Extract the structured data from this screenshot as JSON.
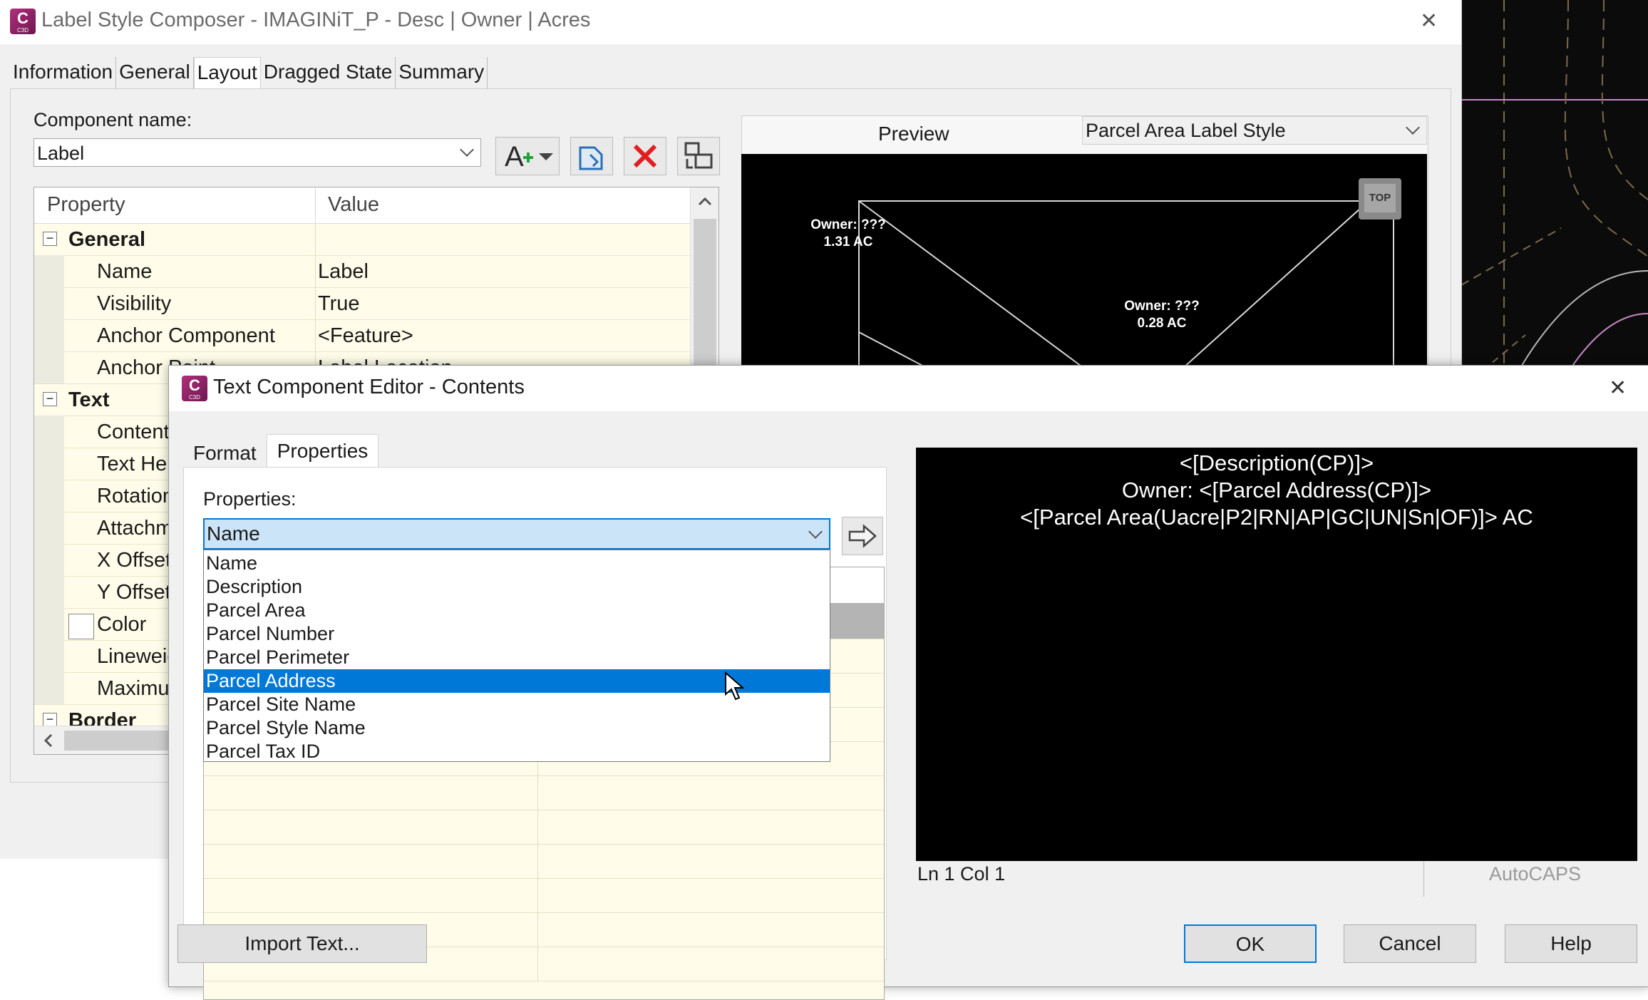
{
  "composer": {
    "title": "Label Style Composer - IMAGINiT_P - Desc | Owner | Acres",
    "close_glyph": "✕",
    "tabs": [
      "Information",
      "General",
      "Layout",
      "Dragged State",
      "Summary"
    ],
    "active_tab": "Layout",
    "component_name_label": "Component name:",
    "component_name_value": "Label",
    "grid": {
      "col_property": "Property",
      "col_value": "Value",
      "rows": [
        {
          "name": "General",
          "value": "",
          "category": true
        },
        {
          "name": "Name",
          "value": "Label"
        },
        {
          "name": "Visibility",
          "value": "True"
        },
        {
          "name": "Anchor Component",
          "value": "<Feature>"
        },
        {
          "name": "Anchor Point",
          "value": "Label Location"
        },
        {
          "name": "Text",
          "value": "",
          "category": true
        },
        {
          "name": "Contents",
          "value": ""
        },
        {
          "name": "Text Height",
          "value": ""
        },
        {
          "name": "Rotation Angle",
          "value": ""
        },
        {
          "name": "Attachment",
          "value": ""
        },
        {
          "name": "X Offset",
          "value": ""
        },
        {
          "name": "Y Offset",
          "value": ""
        },
        {
          "name": "Color",
          "value": ""
        },
        {
          "name": "Lineweight",
          "value": ""
        },
        {
          "name": "Maximum Width",
          "value": ""
        },
        {
          "name": "Border",
          "value": "",
          "category": true
        }
      ]
    },
    "preview": {
      "label": "Preview",
      "style_select": "Parcel Area Label Style",
      "view_cube": "TOP",
      "labels": [
        {
          "line1": "Owner: ???",
          "line2": "1.31 AC"
        },
        {
          "line1": "Owner: ???",
          "line2": "0.28 AC"
        }
      ]
    }
  },
  "editor_dialog": {
    "title": "Text Component Editor - Contents",
    "close_glyph": "✕",
    "tabs": [
      "Format",
      "Properties"
    ],
    "active_tab": "Properties",
    "properties_label": "Properties:",
    "properties_value": "Name",
    "dropdown_options": [
      "Name",
      "Description",
      "Parcel Area",
      "Parcel Number",
      "Parcel Perimeter",
      "Parcel Address",
      "Parcel Site Name",
      "Parcel Style Name",
      "Parcel Tax ID"
    ],
    "highlighted_option": "Parcel Address",
    "editor_lines": [
      "<[Description(CP)]>",
      "Owner: <[Parcel Address(CP)]>",
      "<[Parcel Area(Uacre|P2|RN|AP|GC|UN|Sn|OF)]> AC"
    ],
    "status": {
      "position": "Ln 1 Col 1",
      "caps": "AutoCAPS"
    },
    "buttons": {
      "import": "Import Text...",
      "ok": "OK",
      "cancel": "Cancel",
      "help": "Help"
    }
  },
  "colors": {
    "accent": "#0078d7",
    "grid_bg": "#fffde9",
    "canvas": "#000000",
    "logo": "#9b2a6e"
  }
}
